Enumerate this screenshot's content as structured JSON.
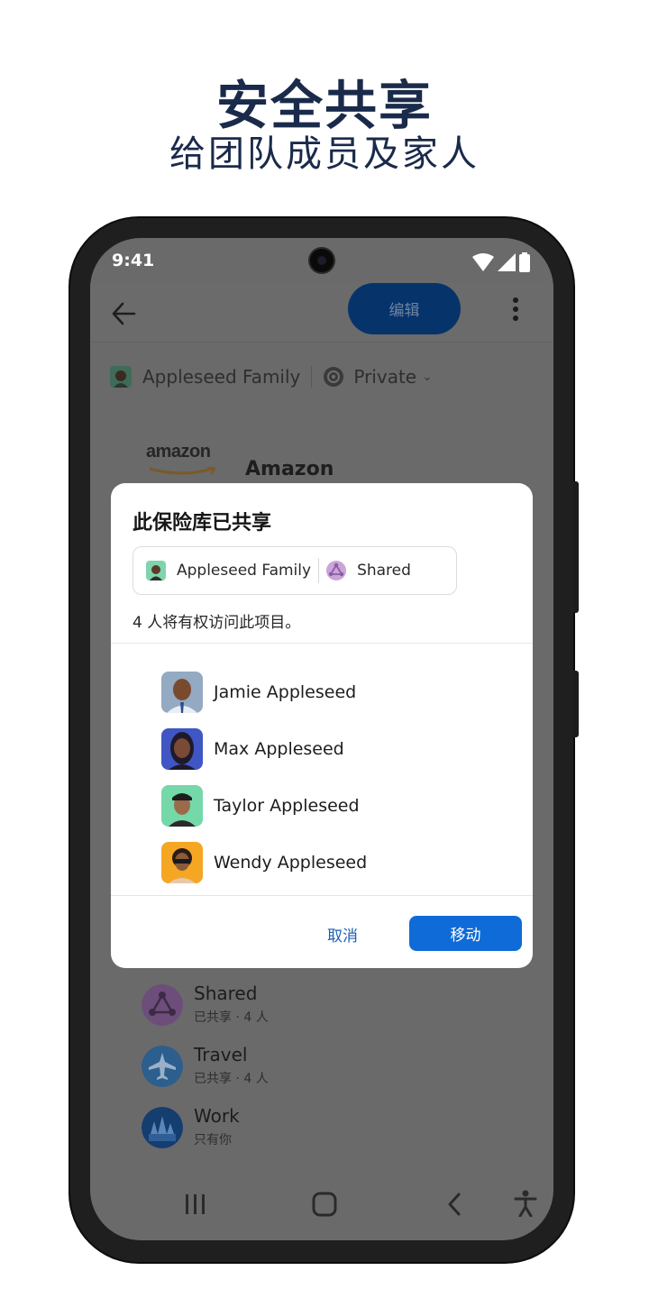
{
  "promo": {
    "headline": "安全共享",
    "subheadline": "给团队成员及家人"
  },
  "status_bar": {
    "time": "9:41"
  },
  "app_bar": {
    "back_icon": "arrow-left-icon",
    "edit_label": "编辑",
    "more_icon": "kebab-menu-icon"
  },
  "vault_selector": {
    "account_name": "Appleseed Family",
    "vault_name": "Private"
  },
  "item": {
    "logo_text": "amazon",
    "title": "Amazon"
  },
  "dialog": {
    "title": "此保险库已共享",
    "chip_account": "Appleseed Family",
    "chip_vault": "Shared",
    "access_text": "4 人将有权访问此项目。",
    "members": [
      {
        "name": "Jamie Appleseed",
        "color": "#8ea3bd"
      },
      {
        "name": "Max Appleseed",
        "color": "#3f56c4"
      },
      {
        "name": "Taylor Appleseed",
        "color": "#6fd6a4"
      },
      {
        "name": "Wendy Appleseed",
        "color": "#f3a623"
      }
    ],
    "cancel_label": "取消",
    "move_label": "移动"
  },
  "vault_list": [
    {
      "name": "Shared",
      "subtitle": "已共享 · 4 人",
      "icon": "shared-vault-icon",
      "color": "#6d4e7a"
    },
    {
      "name": "Travel",
      "subtitle": "已共享 · 4 人",
      "icon": "airplane-icon",
      "color": "#2c5e8e"
    },
    {
      "name": "Work",
      "subtitle": "只有你",
      "icon": "building-icon",
      "color": "#143d70"
    }
  ],
  "colors": {
    "accent": "#0f6bd7",
    "headline": "#1a2a4a",
    "scrim": "#6a6a6a"
  }
}
